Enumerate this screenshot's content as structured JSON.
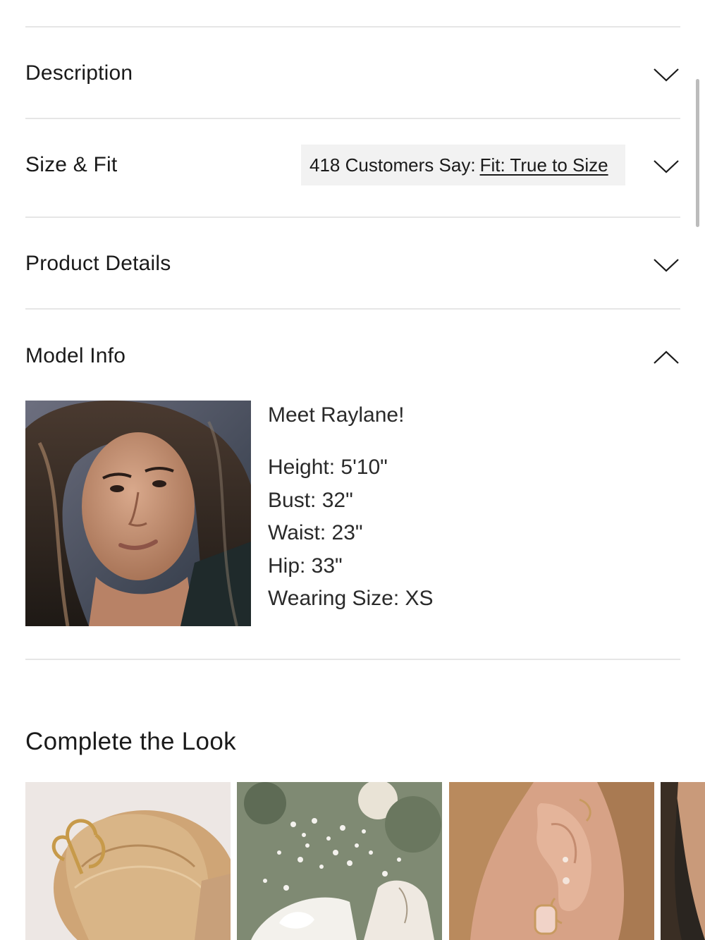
{
  "accordion": {
    "description": {
      "title": "Description",
      "icon": "chevron-down-icon"
    },
    "size_fit": {
      "title": "Size & Fit",
      "icon": "chevron-down-icon",
      "fit_prefix": "418 Customers Say:",
      "fit_link": "Fit: True to Size"
    },
    "product_details": {
      "title": "Product Details",
      "icon": "chevron-down-icon"
    },
    "model_info": {
      "title": "Model Info",
      "icon": "chevron-up-icon"
    }
  },
  "model": {
    "greeting": "Meet Raylane!",
    "height": "Height: 5'10\"",
    "bust": "Bust: 32\"",
    "waist": "Waist: 23\"",
    "hip": "Hip: 33\"",
    "wearing_size": "Wearing Size: XS"
  },
  "complete_look": {
    "title": "Complete the Look",
    "items": [
      "hair-clip-product",
      "white-heels-product",
      "earrings-product",
      "partial-product"
    ]
  },
  "colors": {
    "text": "#1a1a1a",
    "divider": "#e6e6e6",
    "pill_bg": "#f2f2f2"
  }
}
